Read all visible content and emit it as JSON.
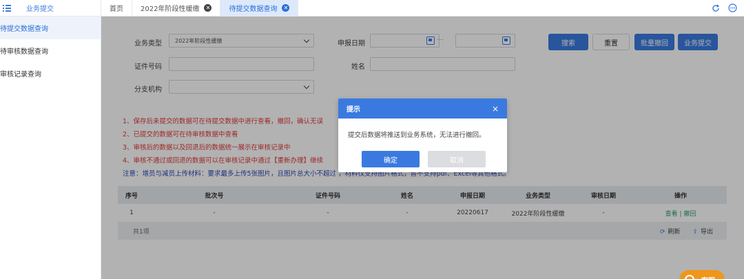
{
  "sidebar": {
    "title": "业务提交",
    "items": [
      {
        "label": "待提交数据查询",
        "active": true
      },
      {
        "label": "待审核数据查询",
        "active": false
      },
      {
        "label": "审核记录查询",
        "active": false
      }
    ]
  },
  "tabs": [
    {
      "label": "首页",
      "closable": false
    },
    {
      "label": "2022年阶段性缓缴",
      "closable": true
    },
    {
      "label": "待提交数据查询",
      "closable": true,
      "active": true
    }
  ],
  "form": {
    "business_type_label": "业务类型",
    "business_type_value": "2022年阶段性缓缴",
    "report_date_label": "申报日期",
    "date_separator": "—",
    "id_number_label": "证件号码",
    "name_label": "姓名",
    "branch_label": "分支机构"
  },
  "buttons": {
    "search": "搜索",
    "reset": "重置",
    "batch_withdraw": "批量撤回",
    "submit": "业务提交"
  },
  "notes": [
    "1、保存后未提交的数据可在待提交数据中进行查看，撤回，确认无误",
    "2、已提交的数据可在待审核数据中查看",
    "3、审核后的数据以及回退后的数据统一展示在审核记录中",
    "4、审核不通过或回退的数据可以在审核记录中通过【重新办理】继续",
    "注意：增员与减员上传材料：要求最多上传5张图片，且图片总大小不超过      ，材料仅支持图片格式，暂不支持pdf、Excel等其他格式。"
  ],
  "table": {
    "headers": [
      "序号",
      "批次号",
      "证件号码",
      "姓名",
      "申报日期",
      "业务类型",
      "审核日期",
      "操作"
    ],
    "rows": [
      [
        "1",
        "-",
        "-",
        "-",
        "20220617",
        "2022年阶段性缓缴",
        "-",
        "查看 | 撤回"
      ]
    ],
    "footer": {
      "count": "共1项",
      "refresh": "刷新",
      "export": "导出"
    }
  },
  "dialog": {
    "title": "提示",
    "close": "×",
    "message": "提交后数据将推送到业务系统，无法进行撤回。",
    "ok": "确定",
    "cancel": "取消"
  },
  "float_button": {
    "label": "客服"
  }
}
